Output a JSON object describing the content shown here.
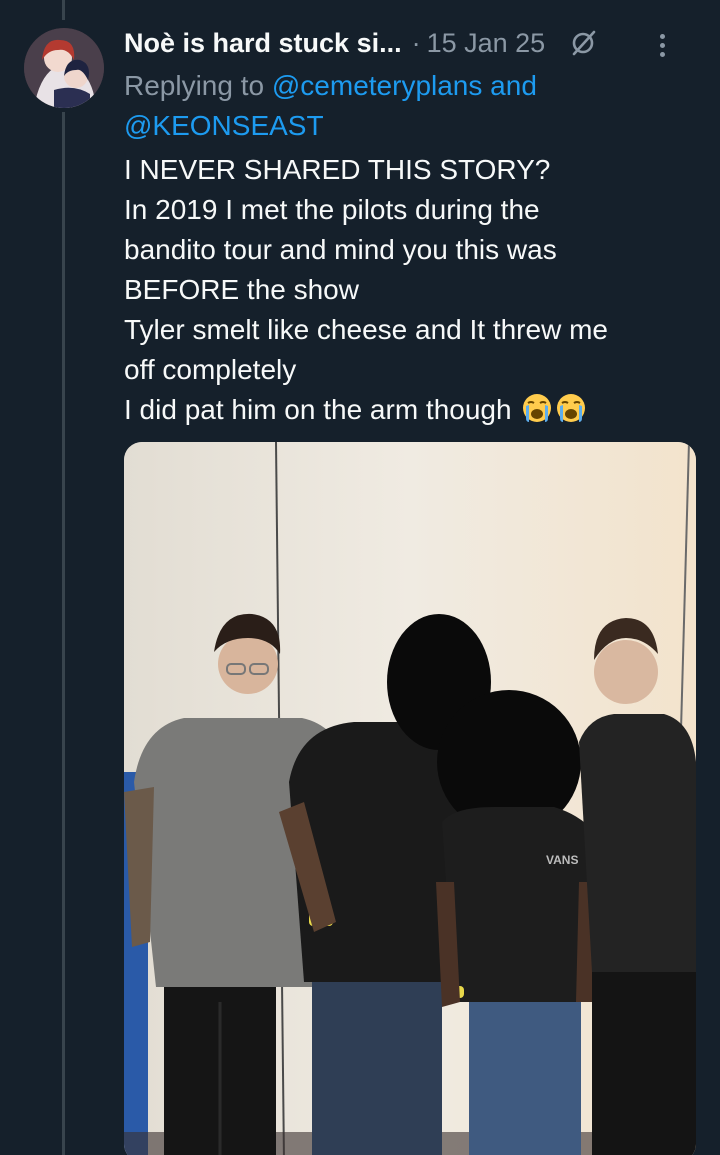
{
  "tweet": {
    "display_name": "Noè is hard stuck si...",
    "separator": "·",
    "timestamp": "15 Jan 25",
    "replying_prefix": "Replying to",
    "reply_mention_1": "@cemeteryplans",
    "reply_and": "and",
    "reply_mention_2": "@KEONSEAST",
    "text_lines": [
      "I NEVER SHARED THIS STORY?",
      "In 2019 I met the pilots during the",
      "bandito tour and mind you this was",
      "BEFORE the show",
      "Tyler smelt like cheese and It threw me",
      "off completely",
      "I did pat him on the arm though"
    ],
    "emoji": [
      "loudly-crying-face",
      "loudly-crying-face"
    ],
    "shirt_text": "VANS"
  },
  "icons": {
    "mute": "circle-slash-icon",
    "more": "more-vertical-icon"
  },
  "colors": {
    "background": "#15202b",
    "text_primary": "#f7f9f9",
    "text_secondary": "#8b98a5",
    "accent": "#1d9bf0",
    "thread_line": "#38444d"
  }
}
